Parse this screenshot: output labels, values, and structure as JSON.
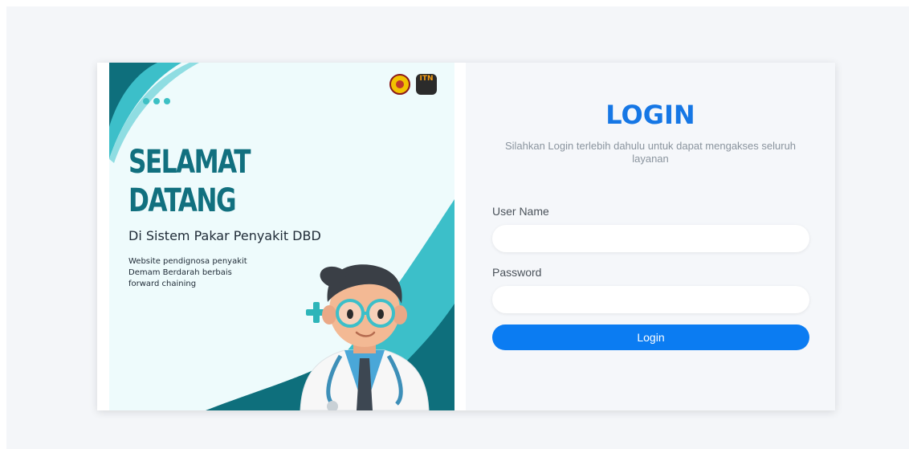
{
  "banner": {
    "title_line1": "SELAMAT",
    "title_line2": "DATANG",
    "subtitle": "Di Sistem Pakar Penyakit DBD",
    "description": "Website pendignosa penyakit Demam Berdarah berbais forward chaining",
    "logo2_text": "ITN",
    "accent_color": "#11707f",
    "wave_color": "#3cbfc9",
    "logos": [
      "university-seal-icon",
      "institution-logo-icon"
    ]
  },
  "login": {
    "title": "LOGIN",
    "subtitle": "Silahkan Login terlebih dahulu untuk dapat mengakses seluruh layanan",
    "username_label": "User Name",
    "username_value": "",
    "password_label": "Password",
    "password_value": "",
    "button_label": "Login",
    "button_color": "#0b7cf2",
    "title_color": "#1677e5"
  }
}
